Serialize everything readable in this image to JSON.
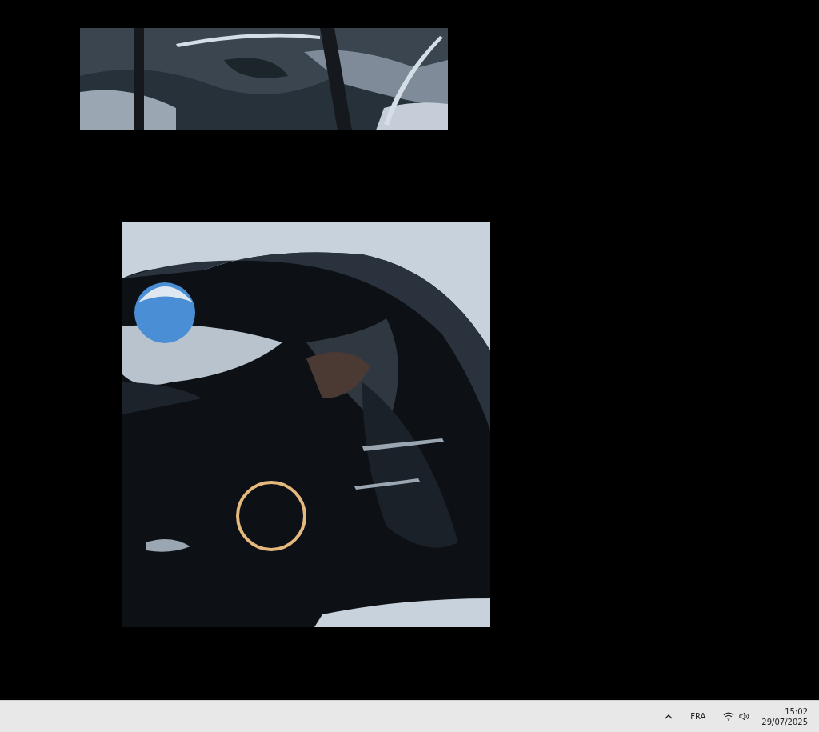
{
  "taskbar": {
    "language": "FRA",
    "time": "15:02",
    "date": "29/07/2025"
  }
}
